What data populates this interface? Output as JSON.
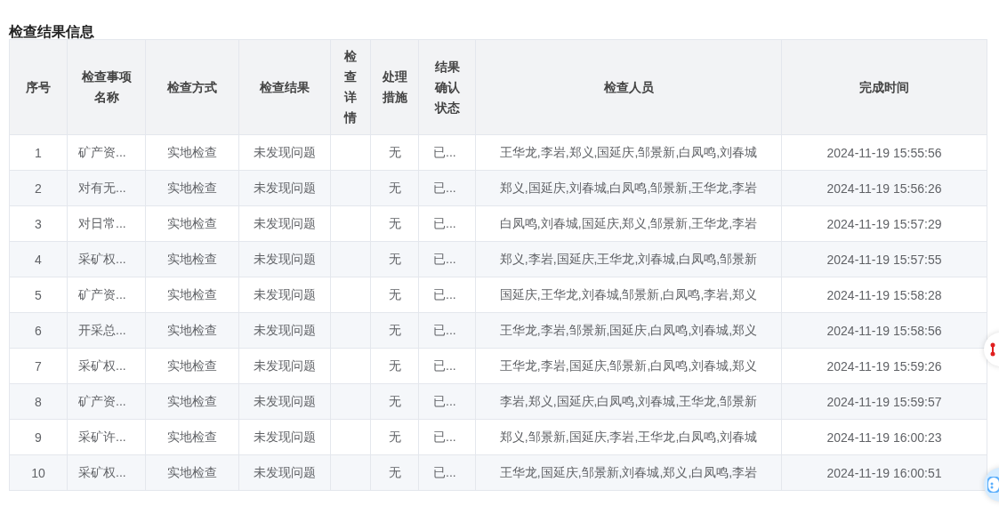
{
  "title": "检查结果信息",
  "table": {
    "columns": [
      "序号",
      "检查事项名称",
      "检查方式",
      "检查结果",
      "检查详情",
      "处理措施",
      "结果确认状态",
      "检查人员",
      "完成时间"
    ],
    "rows": [
      [
        "1",
        "矿产资...",
        "实地检查",
        "未发现问题",
        "",
        "无",
        "已...",
        "王华龙,李岩,郑义,国延庆,邹景新,白凤鸣,刘春城",
        "2024-11-19 15:55:56"
      ],
      [
        "2",
        "对有无...",
        "实地检查",
        "未发现问题",
        "",
        "无",
        "已...",
        "郑义,国延庆,刘春城,白凤鸣,邹景新,王华龙,李岩",
        "2024-11-19 15:56:26"
      ],
      [
        "3",
        "对日常...",
        "实地检查",
        "未发现问题",
        "",
        "无",
        "已...",
        "白凤鸣,刘春城,国延庆,郑义,邹景新,王华龙,李岩",
        "2024-11-19 15:57:29"
      ],
      [
        "4",
        "采矿权...",
        "实地检查",
        "未发现问题",
        "",
        "无",
        "已...",
        "郑义,李岩,国延庆,王华龙,刘春城,白凤鸣,邹景新",
        "2024-11-19 15:57:55"
      ],
      [
        "5",
        "矿产资...",
        "实地检查",
        "未发现问题",
        "",
        "无",
        "已...",
        "国延庆,王华龙,刘春城,邹景新,白凤鸣,李岩,郑义",
        "2024-11-19 15:58:28"
      ],
      [
        "6",
        "开采总...",
        "实地检查",
        "未发现问题",
        "",
        "无",
        "已...",
        "王华龙,李岩,邹景新,国延庆,白凤鸣,刘春城,郑义",
        "2024-11-19 15:58:56"
      ],
      [
        "7",
        "采矿权...",
        "实地检查",
        "未发现问题",
        "",
        "无",
        "已...",
        "王华龙,李岩,国延庆,邹景新,白凤鸣,刘春城,郑义",
        "2024-11-19 15:59:26"
      ],
      [
        "8",
        "矿产资...",
        "实地检查",
        "未发现问题",
        "",
        "无",
        "已...",
        "李岩,郑义,国延庆,白凤鸣,刘春城,王华龙,邹景新",
        "2024-11-19 15:59:57"
      ],
      [
        "9",
        "采矿许...",
        "实地检查",
        "未发现问题",
        "",
        "无",
        "已...",
        "郑义,邹景新,国延庆,李岩,王华龙,白凤鸣,刘春城",
        "2024-11-19 16:00:23"
      ],
      [
        "10",
        "采矿权...",
        "实地检查",
        "未发现问题",
        "",
        "无",
        "已...",
        "王华龙,国延庆,邹景新,刘春城,郑义,白凤鸣,李岩",
        "2024-11-19 16:00:51"
      ]
    ]
  }
}
